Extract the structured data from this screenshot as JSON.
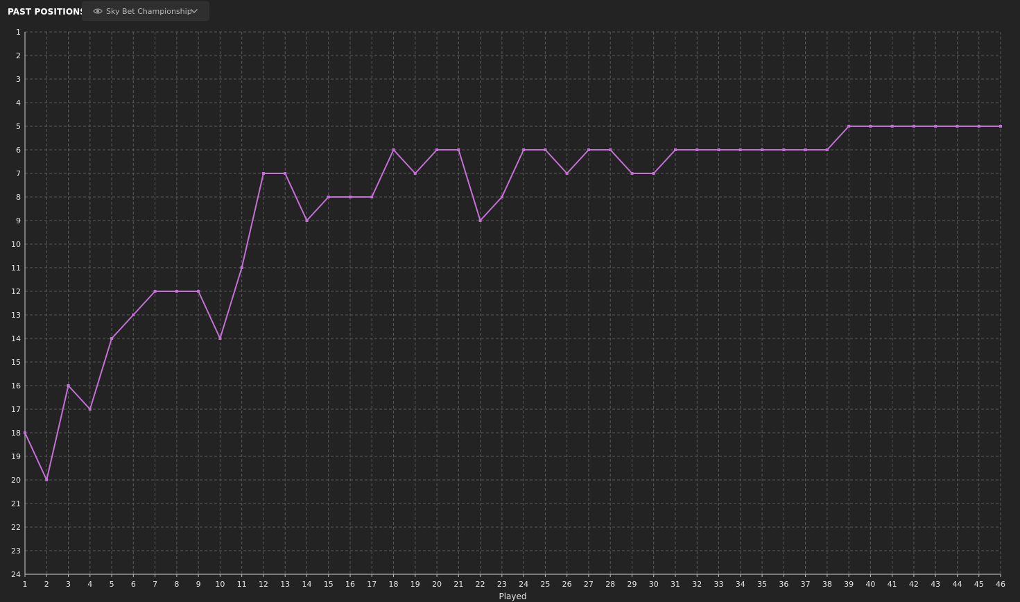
{
  "header": {
    "title": "PAST POSITIONS",
    "league_select": {
      "icon": "eye-icon",
      "value": "Sky Bet Championship",
      "chevron": "chevron-down-icon"
    }
  },
  "colors": {
    "background": "#232323",
    "line": "#c471d6",
    "grid": "#5a5a5a",
    "text": "#e6e6e6"
  },
  "chart_data": {
    "type": "line",
    "title": "PAST POSITIONS",
    "xlabel": "Played",
    "ylabel": "",
    "x": [
      1,
      2,
      3,
      4,
      5,
      6,
      7,
      8,
      9,
      10,
      11,
      12,
      13,
      14,
      15,
      16,
      17,
      18,
      19,
      20,
      21,
      22,
      23,
      24,
      25,
      26,
      27,
      28,
      29,
      30,
      31,
      32,
      33,
      34,
      35,
      36,
      37,
      38,
      39,
      40,
      41,
      42,
      43,
      44,
      45,
      46
    ],
    "series": [
      {
        "values": [
          18,
          20,
          16,
          17,
          14,
          13,
          12,
          12,
          12,
          14,
          11,
          7,
          7,
          9,
          8,
          8,
          8,
          6,
          7,
          6,
          6,
          9,
          8,
          6,
          6,
          7,
          6,
          6,
          7,
          7,
          6,
          6,
          6,
          6,
          6,
          6,
          6,
          6,
          5,
          5,
          5,
          5,
          5,
          5,
          5,
          5
        ]
      }
    ],
    "xlim": [
      1,
      46
    ],
    "ylim": [
      1,
      24
    ],
    "y_inverted": true,
    "grid": true
  }
}
